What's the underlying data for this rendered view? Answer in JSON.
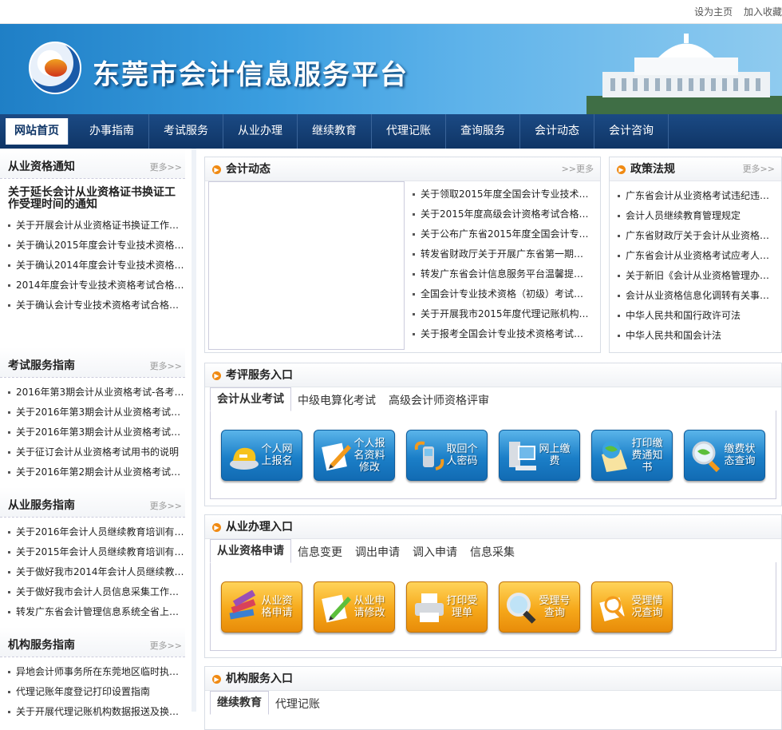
{
  "top_links": [
    "设为主页",
    "加入收藏"
  ],
  "site": {
    "title": "东莞市会计信息服务平台"
  },
  "nav": [
    "网站首页",
    "办事指南",
    "考试服务",
    "从业办理",
    "继续教育",
    "代理记账",
    "查询服务",
    "会计动态",
    "会计咨询"
  ],
  "sidebar": {
    "more_label": "更多>>",
    "sections": [
      {
        "title": "从业资格通知",
        "featured": "关于延长会计从业资格证书换证工作受理时间的通知",
        "items": [
          "关于开展会计从业资格证书换证工作…",
          "关于确认2015年度会计专业技术资格…",
          "关于确认2014年度会计专业技术资格…",
          "2014年度会计专业技术资格考试合格…",
          "关于确认会计专业技术资格考试合格…"
        ]
      },
      {
        "title": "考试服务指南",
        "items": [
          "2016年第3期会计从业资格考试-各考…",
          "关于2016年第3期会计从业资格考试…",
          "关于2016年第3期会计从业资格考试…",
          "关于征订会计从业资格考试用书的说明",
          "关于2016年第2期会计从业资格考试…"
        ]
      },
      {
        "title": "从业服务指南",
        "items": [
          "关于2016年会计人员继续教育培训有…",
          "关于2015年会计人员继续教育培训有…",
          "关于做好我市2014年会计人员继续教…",
          "关于做好我市会计人员信息采集工作…",
          "转发广东省会计管理信息系统全省上…"
        ]
      },
      {
        "title": "机构服务指南",
        "items": [
          "异地会计师事务所在东莞地区临时执…",
          "代理记账年度登记打印设置指南",
          "关于开展代理记账机构数据报送及换…"
        ]
      }
    ]
  },
  "news": {
    "title": "会计动态",
    "more_label": ">>更多",
    "items": [
      "关于领取2015年度全国会计专业技术…",
      "关于2015年度高级会计资格考试合格…",
      "关于公布广东省2015年度全国会计专…",
      "转发省财政厅关于开展广东省第一期…",
      "转发广东省会计信息服务平台温馨提…",
      "全国会计专业技术资格（初级）考试…",
      "关于开展我市2015年度代理记账机构…",
      "关于报考全国会计专业技术资格考试…"
    ]
  },
  "policy": {
    "title": "政策法规",
    "more_label": "更多>>",
    "items": [
      "广东省会计从业资格考试违纪违…",
      "会计人员继续教育管理规定",
      "广东省财政厅关于会计从业资格…",
      "广东省会计从业资格考试应考人…",
      "关于新旧《会计从业资格管理办…",
      "会计从业资格信息化调转有关事…",
      "中华人民共和国行政许可法",
      "中华人民共和国会计法"
    ]
  },
  "exam_service": {
    "title": "考评服务入口",
    "tabs": [
      "会计从业考试",
      "中级电算化考试",
      "高级会计师资格评审"
    ],
    "buttons": [
      {
        "label": "个人网上报名",
        "icon": "helmet-icon"
      },
      {
        "label": "个人报名资料修改",
        "icon": "pencil-note-icon"
      },
      {
        "label": "取回个人密码",
        "icon": "phone-icon"
      },
      {
        "label": "网上缴费",
        "icon": "computer-icon"
      },
      {
        "label": "打印缴费通知书",
        "icon": "globe-document-icon"
      },
      {
        "label": "缴费状态查询",
        "icon": "magnifier-globe-icon"
      }
    ]
  },
  "practice_service": {
    "title": "从业办理入口",
    "tabs": [
      "从业资格申请",
      "信息变更",
      "调出申请",
      "调入申请",
      "信息采集"
    ],
    "buttons": [
      {
        "label": "从业资格申请",
        "icon": "books-icon"
      },
      {
        "label": "从业申请修改",
        "icon": "pencil-note-icon"
      },
      {
        "label": "打印受理单",
        "icon": "printer-icon"
      },
      {
        "label": "受理号查询",
        "icon": "magnifier-icon"
      },
      {
        "label": "受理情况查询",
        "icon": "search-document-icon"
      }
    ]
  },
  "agency_service": {
    "title": "机构服务入口",
    "tabs": [
      "继续教育",
      "代理记账"
    ]
  },
  "colors": {
    "nav": "#0f3566",
    "banner": "#2f8fd8",
    "accent": "#f08a12",
    "blue_button": "#1b7fc8",
    "orange_button": "#f6a81a"
  }
}
